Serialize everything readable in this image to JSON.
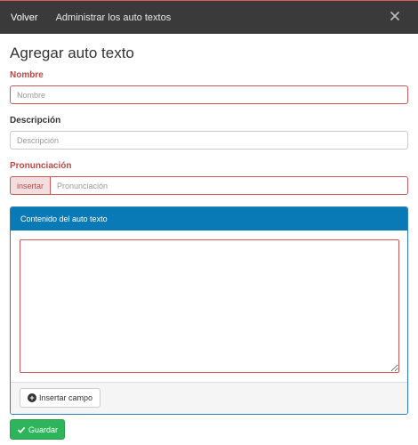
{
  "header": {
    "back_label": "Volver",
    "title": "Administrar los auto textos"
  },
  "form": {
    "heading": "Agregar auto texto",
    "nombre": {
      "label": "Nombre",
      "placeholder": "Nombre",
      "value": ""
    },
    "descripcion": {
      "label": "Descripción",
      "placeholder": "Descripción",
      "value": ""
    },
    "pronunciacion": {
      "label": "Pronunciación",
      "addon_label": "insertar",
      "placeholder": "Pronunciación",
      "value": ""
    },
    "panel": {
      "title": "Contenido del auto texto",
      "content": "",
      "insert_field_label": "Insertar campo"
    },
    "save_label": "Guardar"
  },
  "colors": {
    "topbar": "#3a3a3a",
    "error": "#b94a48",
    "panel_header": "#0a7ab6",
    "save_button": "#2eb55b"
  },
  "icons": [
    "close-icon",
    "plus-circle-icon",
    "check-icon",
    "resize-grip-icon"
  ]
}
